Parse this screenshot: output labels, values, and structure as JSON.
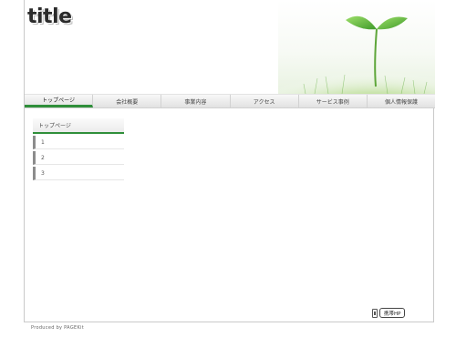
{
  "site": {
    "logo_text": "title"
  },
  "nav": {
    "items": [
      {
        "label": "トップページ",
        "active": true
      },
      {
        "label": "会社概要",
        "active": false
      },
      {
        "label": "事業内容",
        "active": false
      },
      {
        "label": "アクセス",
        "active": false
      },
      {
        "label": "サービス事例",
        "active": false
      },
      {
        "label": "個人情報保護",
        "active": false
      }
    ]
  },
  "sidebar": {
    "heading": "トップページ",
    "items": [
      {
        "label": "1"
      },
      {
        "label": "2"
      },
      {
        "label": "3"
      }
    ]
  },
  "mobile": {
    "label": "携帯HP",
    "icon": "mobile-phone-icon"
  },
  "footer": {
    "text": "Produced by PAGEKit"
  },
  "colors": {
    "accent": "#2f8f3a",
    "grass": "#7cc34a"
  }
}
